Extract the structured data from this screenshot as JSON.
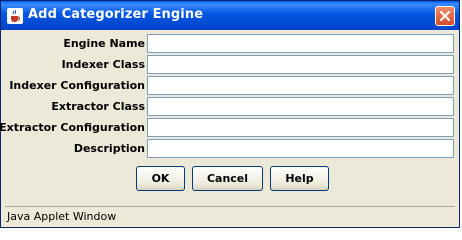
{
  "window": {
    "title": "Add Categorizer Engine"
  },
  "icons": {
    "app": "java-coffee-cup-icon",
    "close": "close-icon"
  },
  "form": {
    "fields": [
      {
        "label": "Engine Name",
        "value": ""
      },
      {
        "label": "Indexer Class",
        "value": ""
      },
      {
        "label": "Indexer Configuration",
        "value": ""
      },
      {
        "label": "Extractor Class",
        "value": ""
      },
      {
        "label": "Extractor Configuration",
        "value": ""
      },
      {
        "label": "Description",
        "value": ""
      }
    ]
  },
  "buttons": {
    "ok": "OK",
    "cancel": "Cancel",
    "help": "Help"
  },
  "status_bar": {
    "text": "Java Applet Window"
  },
  "colors": {
    "titlebar": "#0054e3",
    "close_button": "#e04a27",
    "dialog_background": "#ece9d8",
    "input_border": "#7f9db9"
  }
}
